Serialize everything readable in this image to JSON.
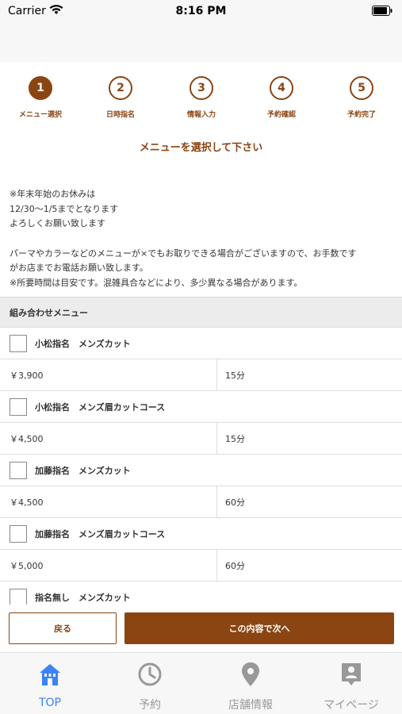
{
  "status_bar": {
    "carrier": "Carrier",
    "time": "8:16 PM"
  },
  "steps": [
    {
      "number": "1",
      "label": "メニュー選択",
      "active": true
    },
    {
      "number": "2",
      "label": "日時指名",
      "active": false
    },
    {
      "number": "3",
      "label": "情報入力",
      "active": false
    },
    {
      "number": "4",
      "label": "予約確認",
      "active": false
    },
    {
      "number": "5",
      "label": "予約完了",
      "active": false
    }
  ],
  "page_heading": "メニューを選択して下さい",
  "notice": {
    "line1": "※年末年始のお休みは",
    "line2": "12/30〜1/5までとなります",
    "line3": "よろしくお願い致します",
    "line4": "パーマやカラーなどのメニューが×でもお取りできる場合がございますので、お手数です",
    "line5": "がお店までお電話お願い致します。",
    "line6": "※所要時間は目安です。混雑具合などにより、多少異なる場合があります。"
  },
  "section_header": "組み合わせメニュー",
  "menu_items": [
    {
      "name": "小松指名　メンズカット",
      "price": "￥3,900",
      "duration": "15分"
    },
    {
      "name": "小松指名　メンズ眉カットコース",
      "price": "￥4,500",
      "duration": "15分"
    },
    {
      "name": "加藤指名　メンズカット",
      "price": "￥4,500",
      "duration": "60分"
    },
    {
      "name": "加藤指名　メンズ眉カットコース",
      "price": "￥5,000",
      "duration": "60分"
    },
    {
      "name": "指名無し　メンズカット",
      "price": "",
      "duration": ""
    }
  ],
  "buttons": {
    "back": "戻る",
    "next": "この内容で次へ"
  },
  "tab_bar": {
    "accent_color": "#3b82f6",
    "items": [
      {
        "label": "TOP",
        "icon": "home-icon",
        "active": true
      },
      {
        "label": "予約",
        "icon": "clock-icon",
        "active": false
      },
      {
        "label": "店舗情報",
        "icon": "map-pin-icon",
        "active": false
      },
      {
        "label": "マイページ",
        "icon": "profile-icon",
        "active": false
      }
    ]
  },
  "colors": {
    "brand": "#8b4513",
    "tab_active": "#3b82f6",
    "tab_inactive": "#999999"
  }
}
